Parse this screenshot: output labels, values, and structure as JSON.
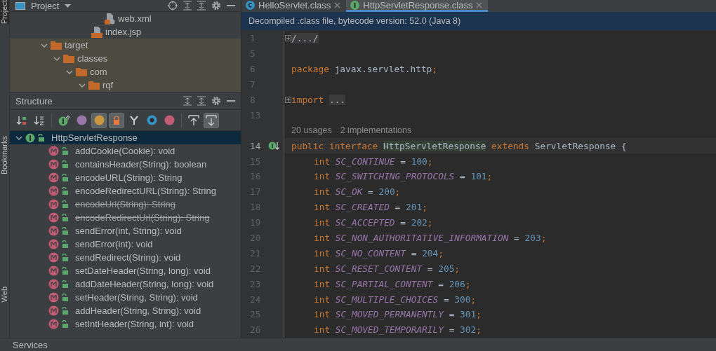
{
  "side_strip": [
    {
      "label": "Project",
      "selected": true
    },
    {
      "label": "Bookmarks",
      "selected": false
    },
    {
      "label": "Web",
      "selected": false
    }
  ],
  "project": {
    "title": "Project",
    "tree": [
      {
        "label": "web.xml",
        "kind": "xml"
      },
      {
        "label": "index.jsp",
        "kind": "jsp"
      },
      {
        "label": "target",
        "kind": "folder",
        "expanded": true,
        "excluded": true,
        "children": [
          {
            "label": "classes",
            "kind": "folder",
            "expanded": true,
            "children": [
              {
                "label": "com",
                "kind": "folder",
                "expanded": true,
                "children": [
                  {
                    "label": "rqf",
                    "kind": "folder",
                    "expanded": true
                  }
                ]
              }
            ]
          }
        ]
      }
    ]
  },
  "structure": {
    "title": "Structure",
    "toolbar": [
      {
        "kind": "sort-visibility",
        "on": false
      },
      {
        "kind": "sort-alpha",
        "on": false
      },
      {
        "kind": "sep"
      },
      {
        "kind": "inherited",
        "on": false
      },
      {
        "kind": "properties",
        "on": false
      },
      {
        "kind": "fields",
        "on": true
      },
      {
        "kind": "non-public",
        "on": true
      },
      {
        "kind": "anonymous",
        "on": false
      },
      {
        "kind": "interfaces",
        "on": false
      },
      {
        "kind": "lambdas",
        "on": false
      },
      {
        "kind": "sep"
      },
      {
        "kind": "autoscroll-to",
        "on": false
      },
      {
        "kind": "autoscroll-from",
        "on": true
      }
    ],
    "root": {
      "label": "HttpServletResponse",
      "expanded": true,
      "selected": true
    },
    "members": [
      {
        "label": "addCookie(Cookie): void",
        "deprecated": false
      },
      {
        "label": "containsHeader(String): boolean",
        "deprecated": false
      },
      {
        "label": "encodeURL(String): String",
        "deprecated": false
      },
      {
        "label": "encodeRedirectURL(String): String",
        "deprecated": false
      },
      {
        "label": "encodeUrl(String): String",
        "deprecated": true
      },
      {
        "label": "encodeRedirectUrl(String): String",
        "deprecated": true
      },
      {
        "label": "sendError(int, String): void",
        "deprecated": false
      },
      {
        "label": "sendError(int): void",
        "deprecated": false
      },
      {
        "label": "sendRedirect(String): void",
        "deprecated": false
      },
      {
        "label": "setDateHeader(String, long): void",
        "deprecated": false
      },
      {
        "label": "addDateHeader(String, long): void",
        "deprecated": false
      },
      {
        "label": "setHeader(String, String): void",
        "deprecated": false
      },
      {
        "label": "addHeader(String, String): void",
        "deprecated": false
      },
      {
        "label": "setIntHeader(String, int): void",
        "deprecated": false
      }
    ]
  },
  "editor": {
    "tabs": [
      {
        "label": "HelloServlet.class",
        "kind": "class",
        "selected": false
      },
      {
        "label": "HttpServletResponse.class",
        "kind": "interface",
        "selected": true
      }
    ],
    "banner": "Decompiled .class file, bytecode version: 52.0 (Java 8)",
    "lines": [
      {
        "number": "1",
        "foldable": true,
        "tokens": [
          {
            "kind": "folded",
            "text": "/.../"
          }
        ]
      },
      {
        "number": "5"
      },
      {
        "number": "6",
        "tokens": [
          {
            "kind": "keyword",
            "text": "package "
          },
          {
            "kind": "plain",
            "text": "javax.servlet.http"
          },
          {
            "kind": "punct",
            "text": ";"
          }
        ]
      },
      {
        "number": "7"
      },
      {
        "number": "8",
        "foldable": true,
        "tokens": [
          {
            "kind": "keyword",
            "text": "import "
          },
          {
            "kind": "folded",
            "text": "..."
          }
        ]
      },
      {
        "number": "13"
      },
      {
        "kind": "inlay",
        "hints": [
          "20 usages",
          "2 implementations"
        ]
      },
      {
        "number": "14",
        "implemented": true,
        "current": true,
        "tokens": [
          {
            "kind": "keyword",
            "text": "public interface "
          },
          {
            "kind": "highlight",
            "text": "HttpServletResponse"
          },
          {
            "kind": "keyword",
            "text": " extends "
          },
          {
            "kind": "plain",
            "text": "ServletResponse {"
          }
        ]
      },
      {
        "number": "15",
        "indented": true,
        "tokens": [
          {
            "kind": "keyword",
            "text": "int "
          },
          {
            "kind": "const",
            "text": "SC_CONTINUE"
          },
          {
            "kind": "plain",
            "text": " = "
          },
          {
            "kind": "number",
            "text": "100"
          },
          {
            "kind": "punct",
            "text": ";"
          }
        ]
      },
      {
        "number": "16",
        "indented": true,
        "tokens": [
          {
            "kind": "keyword",
            "text": "int "
          },
          {
            "kind": "const",
            "text": "SC_SWITCHING_PROTOCOLS"
          },
          {
            "kind": "plain",
            "text": " = "
          },
          {
            "kind": "number",
            "text": "101"
          },
          {
            "kind": "punct",
            "text": ";"
          }
        ]
      },
      {
        "number": "17",
        "indented": true,
        "tokens": [
          {
            "kind": "keyword",
            "text": "int "
          },
          {
            "kind": "const",
            "text": "SC_OK"
          },
          {
            "kind": "plain",
            "text": " = "
          },
          {
            "kind": "number",
            "text": "200"
          },
          {
            "kind": "punct",
            "text": ";"
          }
        ]
      },
      {
        "number": "18",
        "indented": true,
        "tokens": [
          {
            "kind": "keyword",
            "text": "int "
          },
          {
            "kind": "const",
            "text": "SC_CREATED"
          },
          {
            "kind": "plain",
            "text": " = "
          },
          {
            "kind": "number",
            "text": "201"
          },
          {
            "kind": "punct",
            "text": ";"
          }
        ]
      },
      {
        "number": "19",
        "indented": true,
        "tokens": [
          {
            "kind": "keyword",
            "text": "int "
          },
          {
            "kind": "const",
            "text": "SC_ACCEPTED"
          },
          {
            "kind": "plain",
            "text": " = "
          },
          {
            "kind": "number",
            "text": "202"
          },
          {
            "kind": "punct",
            "text": ";"
          }
        ]
      },
      {
        "number": "20",
        "indented": true,
        "tokens": [
          {
            "kind": "keyword",
            "text": "int "
          },
          {
            "kind": "const",
            "text": "SC_NON_AUTHORITATIVE_INFORMATION"
          },
          {
            "kind": "plain",
            "text": " = "
          },
          {
            "kind": "number",
            "text": "203"
          },
          {
            "kind": "punct",
            "text": ";"
          }
        ]
      },
      {
        "number": "21",
        "indented": true,
        "tokens": [
          {
            "kind": "keyword",
            "text": "int "
          },
          {
            "kind": "const",
            "text": "SC_NO_CONTENT"
          },
          {
            "kind": "plain",
            "text": " = "
          },
          {
            "kind": "number",
            "text": "204"
          },
          {
            "kind": "punct",
            "text": ";"
          }
        ]
      },
      {
        "number": "22",
        "indented": true,
        "tokens": [
          {
            "kind": "keyword",
            "text": "int "
          },
          {
            "kind": "const",
            "text": "SC_RESET_CONTENT"
          },
          {
            "kind": "plain",
            "text": " = "
          },
          {
            "kind": "number",
            "text": "205"
          },
          {
            "kind": "punct",
            "text": ";"
          }
        ]
      },
      {
        "number": "23",
        "indented": true,
        "tokens": [
          {
            "kind": "keyword",
            "text": "int "
          },
          {
            "kind": "const",
            "text": "SC_PARTIAL_CONTENT"
          },
          {
            "kind": "plain",
            "text": " = "
          },
          {
            "kind": "number",
            "text": "206"
          },
          {
            "kind": "punct",
            "text": ";"
          }
        ]
      },
      {
        "number": "24",
        "indented": true,
        "tokens": [
          {
            "kind": "keyword",
            "text": "int "
          },
          {
            "kind": "const",
            "text": "SC_MULTIPLE_CHOICES"
          },
          {
            "kind": "plain",
            "text": " = "
          },
          {
            "kind": "number",
            "text": "300"
          },
          {
            "kind": "punct",
            "text": ";"
          }
        ]
      },
      {
        "number": "25",
        "indented": true,
        "tokens": [
          {
            "kind": "keyword",
            "text": "int "
          },
          {
            "kind": "const",
            "text": "SC_MOVED_PERMANENTLY"
          },
          {
            "kind": "plain",
            "text": " = "
          },
          {
            "kind": "number",
            "text": "301"
          },
          {
            "kind": "punct",
            "text": ";"
          }
        ]
      },
      {
        "number": "26",
        "indented": true,
        "tokens": [
          {
            "kind": "keyword",
            "text": "int "
          },
          {
            "kind": "const",
            "text": "SC_MOVED_TEMPORARILY"
          },
          {
            "kind": "plain",
            "text": " = "
          },
          {
            "kind": "number",
            "text": "302"
          },
          {
            "kind": "punct",
            "text": ";"
          }
        ]
      }
    ]
  },
  "status_bar": {
    "label": "Services"
  }
}
